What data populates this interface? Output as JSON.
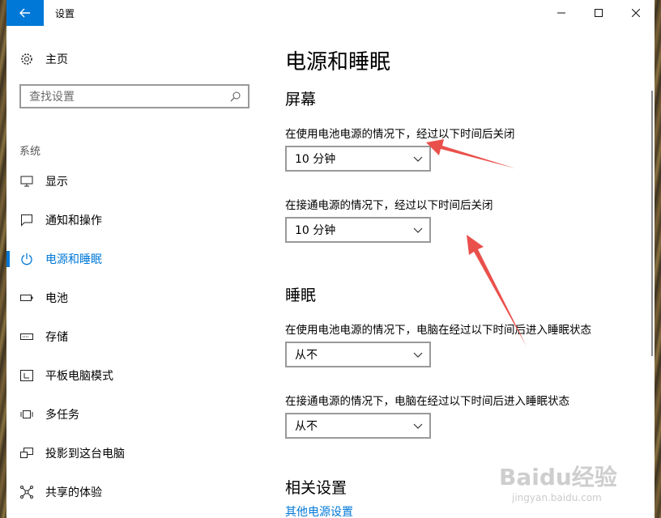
{
  "window": {
    "title": "设置"
  },
  "sidebar": {
    "home_label": "主页",
    "search_placeholder": "查找设置",
    "section_label": "系统",
    "items": [
      {
        "label": "显示",
        "icon": "monitor-icon"
      },
      {
        "label": "通知和操作",
        "icon": "notification-icon"
      },
      {
        "label": "电源和睡眠",
        "icon": "power-icon",
        "active": true
      },
      {
        "label": "电池",
        "icon": "battery-icon"
      },
      {
        "label": "存储",
        "icon": "storage-icon"
      },
      {
        "label": "平板电脑模式",
        "icon": "tablet-mode-icon"
      },
      {
        "label": "多任务",
        "icon": "multitask-icon"
      },
      {
        "label": "投影到这台电脑",
        "icon": "project-icon"
      },
      {
        "label": "共享的体验",
        "icon": "share-icon"
      }
    ]
  },
  "content": {
    "title": "电源和睡眠",
    "screen": {
      "heading": "屏幕",
      "battery_label": "在使用电池电源的情况下，经过以下时间后关闭",
      "battery_value": "10 分钟",
      "plugged_label": "在接通电源的情况下，经过以下时间后关闭",
      "plugged_value": "10 分钟"
    },
    "sleep": {
      "heading": "睡眠",
      "battery_label": "在使用电池电源的情况下，电脑在经过以下时间后进入睡眠状态",
      "battery_value": "从不",
      "plugged_label": "在接通电源的情况下，电脑在经过以下时间后进入睡眠状态",
      "plugged_value": "从不"
    },
    "related": {
      "heading": "相关设置",
      "link": "其他电源设置"
    }
  },
  "watermark": {
    "logo": "Baidu经验",
    "url": "jingyan.baidu.com"
  },
  "colors": {
    "accent": "#0078d7",
    "annotation": "#e8413c"
  }
}
